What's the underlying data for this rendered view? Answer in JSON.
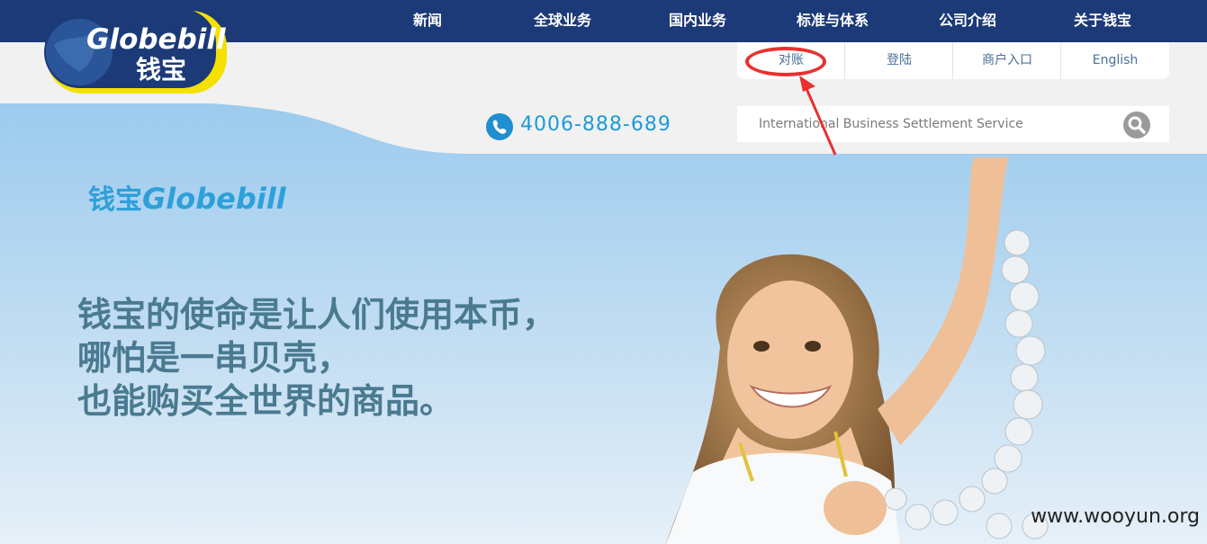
{
  "nav": {
    "items": [
      {
        "label": "新闻"
      },
      {
        "label": "全球业务"
      },
      {
        "label": "国内业务"
      },
      {
        "label": "标准与体系"
      },
      {
        "label": "公司介绍"
      },
      {
        "label": "关于钱宝"
      }
    ]
  },
  "logo": {
    "text_en": "Globebill",
    "text_cn": "钱宝"
  },
  "submenu": {
    "items": [
      {
        "label": "对账"
      },
      {
        "label": "登陆"
      },
      {
        "label": "商户入口"
      },
      {
        "label": "English"
      }
    ]
  },
  "phone": {
    "number": "4006-888-689"
  },
  "search": {
    "placeholder": "International Business Settlement Service"
  },
  "hero": {
    "brand_cn": "钱宝",
    "brand_en": "Globebill",
    "slogan": [
      "钱宝的使命是让人们使用本币，",
      "哪怕是一串贝壳，",
      "也能购买全世界的商品。"
    ]
  },
  "watermark": "www.wooyun.org",
  "colors": {
    "nav_bg": "#1c3a78",
    "accent": "#1e9ad6",
    "annotation": "#e8312f"
  }
}
